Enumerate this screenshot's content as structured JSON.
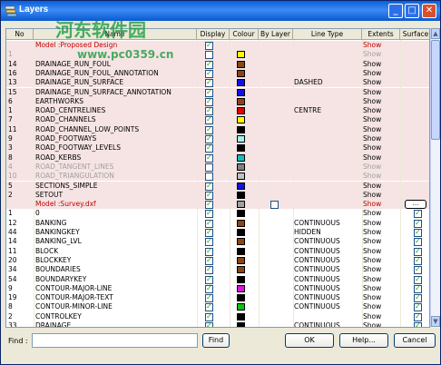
{
  "window": {
    "title": "Layers",
    "minimize": "_",
    "maximize": "□",
    "close": "✕"
  },
  "watermark": {
    "chinese": "河东软件园",
    "url": "www.pc0359.cn"
  },
  "header": {
    "id": "No",
    "name": "Name",
    "display": "Display",
    "colour": "Colour",
    "by_layer": "By Layer",
    "line_type": "Line Type",
    "extents": "Extents",
    "surface": "Surface"
  },
  "rows": [
    {
      "kind": "model",
      "id": "",
      "name": "Model :Proposed Design",
      "display": true,
      "colour": "",
      "ltype": "",
      "extents": "Show",
      "surface": "",
      "pink": true
    },
    {
      "id": "1",
      "name": "",
      "display": false,
      "colour": "#FFFF00",
      "ltype": "",
      "extents": "Show",
      "pink": true,
      "grey": true
    },
    {
      "id": "14",
      "name": "DRAINAGE_RUN_FOUL",
      "display": true,
      "colour": "#8B4513",
      "ltype": "",
      "extents": "Show",
      "pink": true
    },
    {
      "id": "16",
      "name": "DRAINAGE_RUN_FOUL_ANNOTATION",
      "display": true,
      "colour": "#8B4513",
      "ltype": "",
      "extents": "Show",
      "pink": true
    },
    {
      "id": "13",
      "name": "DRAINAGE_RUN_SURFACE",
      "display": true,
      "colour": "#1010E0",
      "ltype": "DASHED",
      "extents": "Show",
      "pink": true
    },
    {
      "id": "15",
      "name": "DRAINAGE_RUN_SURFACE_ANNOTATION",
      "display": true,
      "colour": "#1010E0",
      "ltype": "",
      "extents": "Show",
      "pink": true
    },
    {
      "id": "6",
      "name": "EARTHWORKS",
      "display": true,
      "colour": "#8B4513",
      "ltype": "",
      "extents": "Show",
      "pink": true
    },
    {
      "id": "1",
      "name": "ROAD_CENTRELINES",
      "display": true,
      "colour": "#E00000",
      "ltype": "CENTRE",
      "extents": "Show",
      "pink": true
    },
    {
      "id": "7",
      "name": "ROAD_CHANNELS",
      "display": true,
      "colour": "#FFFF00",
      "ltype": "",
      "extents": "Show",
      "pink": true
    },
    {
      "id": "11",
      "name": "ROAD_CHANNEL_LOW_POINTS",
      "display": true,
      "colour": "#000000",
      "ltype": "",
      "extents": "Show",
      "pink": true
    },
    {
      "id": "9",
      "name": "ROAD_FOOTWAYS",
      "display": true,
      "colour": "#A0F0F0",
      "ltype": "",
      "extents": "Show",
      "pink": true
    },
    {
      "id": "3",
      "name": "ROAD_FOOTWAY_LEVELS",
      "display": true,
      "colour": "#000000",
      "ltype": "",
      "extents": "Show",
      "pink": true
    },
    {
      "id": "8",
      "name": "ROAD_KERBS",
      "display": true,
      "colour": "#10C0C0",
      "ltype": "",
      "extents": "Show",
      "pink": true
    },
    {
      "id": "4",
      "name": "ROAD_TANGENT_LINES",
      "display": false,
      "colour": "#808080",
      "ltype": "",
      "extents": "Show",
      "pink": true,
      "grey": true
    },
    {
      "id": "10",
      "name": "ROAD_TRIANGULATION",
      "display": false,
      "colour": "#C0C0C0",
      "ltype": "",
      "extents": "Show",
      "pink": true,
      "grey": true
    },
    {
      "id": "5",
      "name": "SECTIONS_SIMPLE",
      "display": true,
      "colour": "#1010E0",
      "ltype": "",
      "extents": "Show",
      "pink": true
    },
    {
      "id": "2",
      "name": "SETOUT",
      "display": true,
      "colour": "#000000",
      "ltype": "",
      "extents": "Show",
      "pink": true
    },
    {
      "kind": "model",
      "id": "",
      "name": "Model :Survey.dxf",
      "display": true,
      "colour": "#A0A0A0",
      "bylayer": true,
      "ltype": "",
      "extents": "Show",
      "dots": "...",
      "pink": true
    },
    {
      "id": "1",
      "name": "0",
      "display": true,
      "colour": "#000000",
      "ltype": "",
      "extents": "Show",
      "surface": true
    },
    {
      "id": "12",
      "name": "BANKING",
      "display": true,
      "colour": "#8B4513",
      "ltype": "CONTINUOUS",
      "extents": "Show",
      "surface": true
    },
    {
      "id": "44",
      "name": "BANKINGKEY",
      "display": true,
      "colour": "#000000",
      "ltype": "HIDDEN",
      "extents": "Show",
      "surface": true
    },
    {
      "id": "14",
      "name": "BANKING_LVL",
      "display": true,
      "colour": "#8B4513",
      "ltype": "CONTINUOUS",
      "extents": "Show",
      "surface": true
    },
    {
      "id": "11",
      "name": "BLOCK",
      "display": true,
      "colour": "#000000",
      "ltype": "CONTINUOUS",
      "extents": "Show",
      "surface": true
    },
    {
      "id": "20",
      "name": "BLOCKKEY",
      "display": true,
      "colour": "#8B4513",
      "ltype": "CONTINUOUS",
      "extents": "Show",
      "surface": true
    },
    {
      "id": "34",
      "name": "BOUNDARIES",
      "display": true,
      "colour": "#8B4513",
      "ltype": "CONTINUOUS",
      "extents": "Show",
      "surface": true
    },
    {
      "id": "54",
      "name": "BOUNDARYKEY",
      "display": true,
      "colour": "#000000",
      "ltype": "CONTINUOUS",
      "extents": "Show",
      "surface": true
    },
    {
      "id": "9",
      "name": "CONTOUR-MAJOR-LINE",
      "display": true,
      "colour": "#E010E0",
      "ltype": "CONTINUOUS",
      "extents": "Show",
      "surface": true
    },
    {
      "id": "19",
      "name": "CONTOUR-MAJOR-TEXT",
      "display": true,
      "colour": "#000000",
      "ltype": "CONTINUOUS",
      "extents": "Show",
      "surface": true
    },
    {
      "id": "8",
      "name": "CONTOUR-MINOR-LINE",
      "display": true,
      "colour": "#10C010",
      "ltype": "CONTINUOUS",
      "extents": "Show",
      "surface": true
    },
    {
      "id": "2",
      "name": "CONTROLKEY",
      "display": true,
      "colour": "#000000",
      "ltype": "",
      "extents": "Show",
      "surface": true
    },
    {
      "id": "33",
      "name": "DRAINAGE",
      "display": true,
      "colour": "#000000",
      "ltype": "CONTINUOUS",
      "extents": "Show",
      "surface": true
    }
  ],
  "footer": {
    "find_label": "Find :",
    "find_value": "",
    "find_button": "Find",
    "ok_button": "OK",
    "help_button": "Help...",
    "cancel_button": "Cancel"
  },
  "colors": {
    "accent": "#0A5FD8",
    "model_text": "#C00000",
    "check": "#21A121"
  }
}
